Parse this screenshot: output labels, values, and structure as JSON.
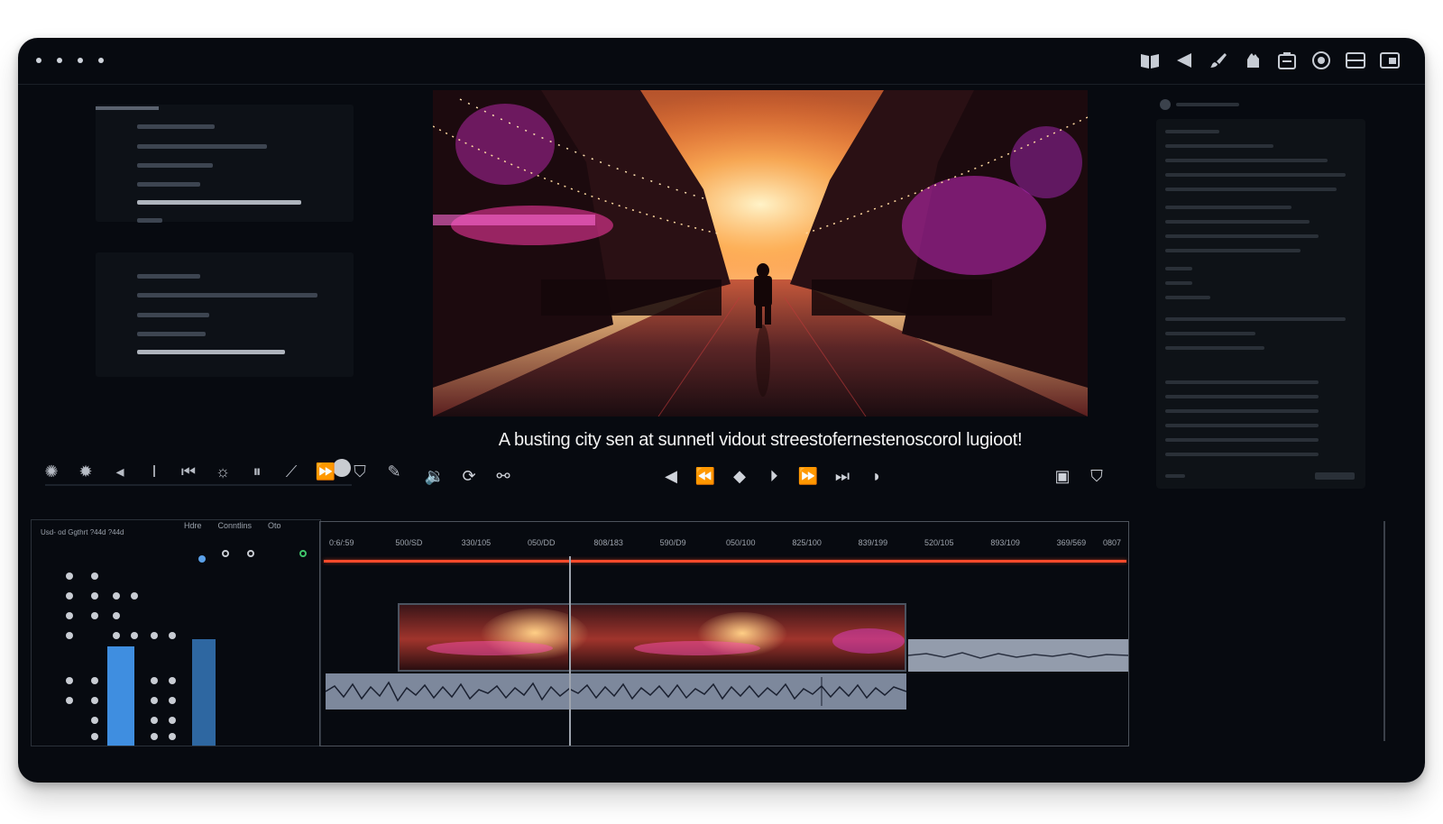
{
  "window": {
    "top_icons": [
      "book-icon",
      "play-back-icon",
      "brush-icon",
      "hand-icon",
      "clipboard-icon",
      "record-icon",
      "panel-icon",
      "window-icon"
    ]
  },
  "preview": {
    "caption": "A busting city sen at sunnetl vidout streestofernestenoscorol lugioot!"
  },
  "transport": {
    "left_buttons": [
      "volume-icon",
      "loop-icon",
      "link-icon"
    ],
    "center_buttons": [
      "prev-frame-icon",
      "rewind-icon",
      "stop-icon",
      "step-icon",
      "fast-forward-icon",
      "skip-end-icon",
      "marker-icon"
    ],
    "right_buttons": [
      "export-icon",
      "shield-icon"
    ]
  },
  "left_tools": [
    "fx-icon",
    "settings-icon",
    "back-icon",
    "text-cursor-icon",
    "skip-start-icon",
    "sun-icon",
    "pause-icon",
    "trim-icon",
    "forward-icon",
    "shield-icon",
    "paint-icon"
  ],
  "timeline": {
    "headers": [
      "Hdre",
      "Conntlins",
      "Oto"
    ],
    "left_header": "Usd- od Ggthrt ?44d ?44d",
    "ticks": [
      "0:6/:59",
      "500/SD",
      "330/105",
      "050/DD",
      "808/183",
      "590/D9",
      "050/100",
      "825/100",
      "839/199",
      "520/105",
      "893/109",
      "369/569",
      "0807"
    ]
  },
  "colors": {
    "accent_red": "#ff4a2b",
    "track_blue": "#3f8ee0",
    "background": "#070a10"
  }
}
